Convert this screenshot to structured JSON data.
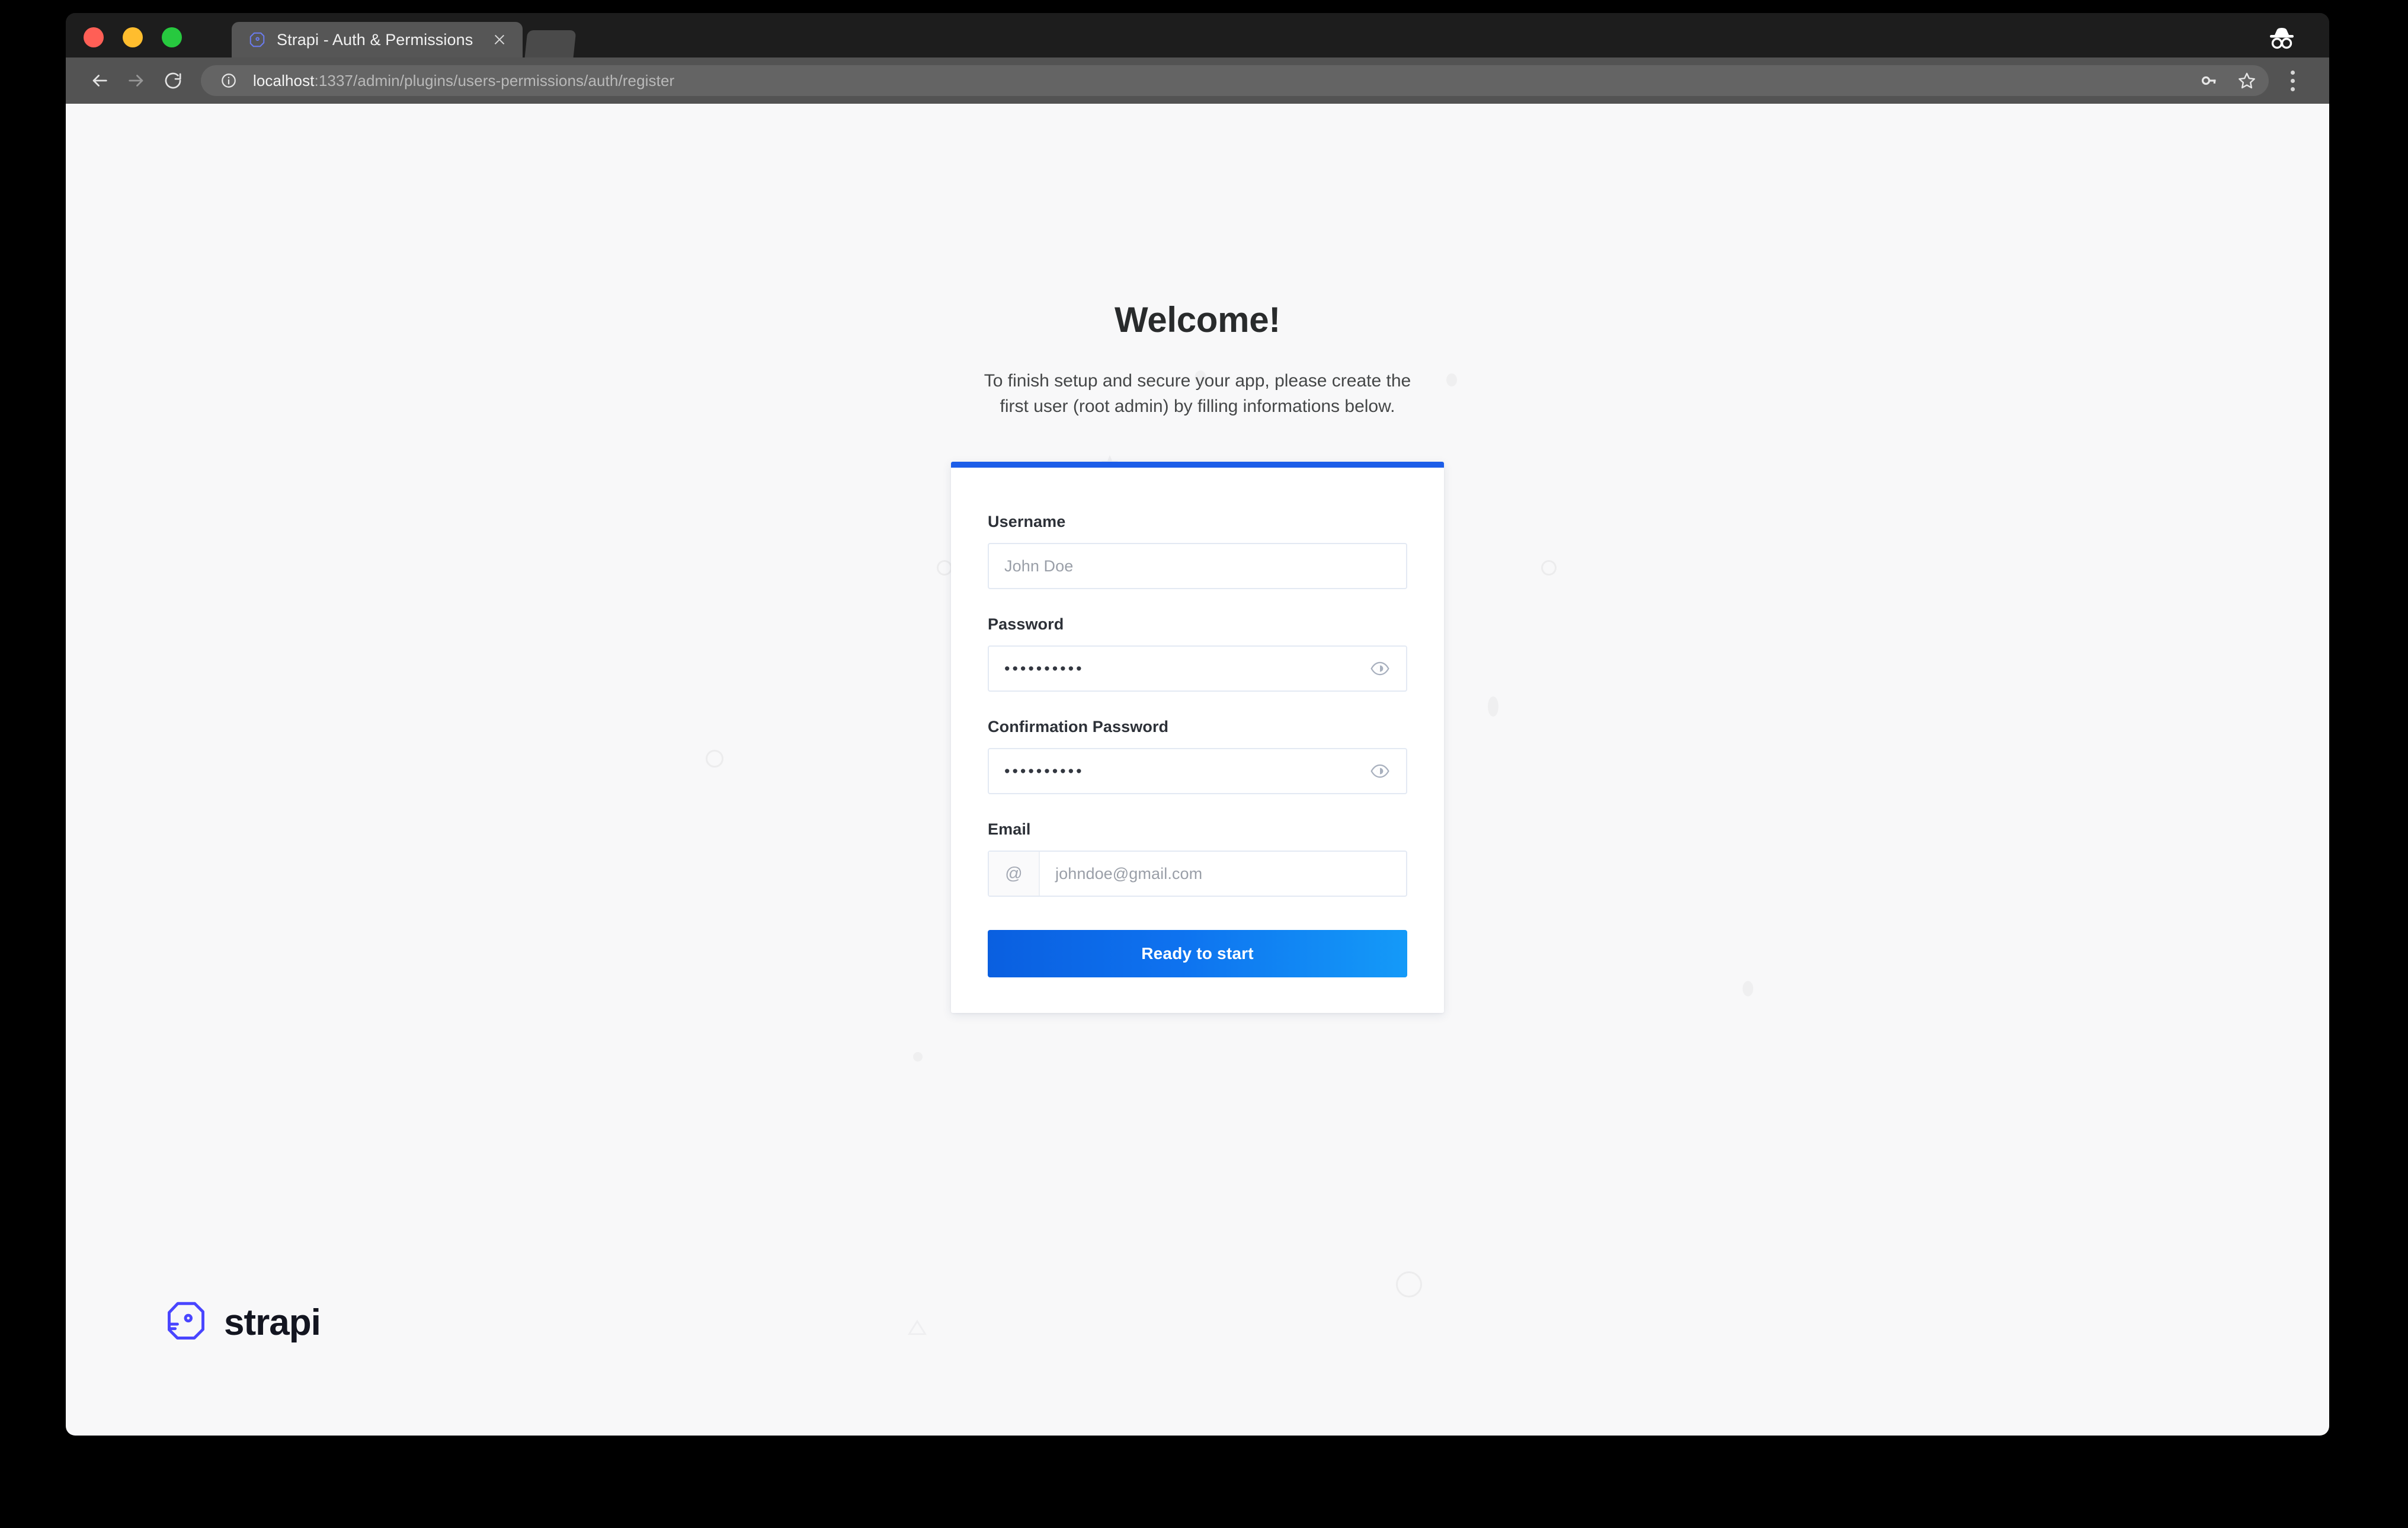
{
  "browser": {
    "tab": {
      "title": "Strapi - Auth & Permissions",
      "favicon_icon": "strapi-favicon",
      "close_icon": "close-icon"
    },
    "new_tab_icon": "new-tab-button",
    "window_controls": {
      "close": "close-window-dot",
      "minimize": "minimize-window-dot",
      "maximize": "maximize-window-dot"
    },
    "incognito_icon": "incognito-icon",
    "nav": {
      "back_icon": "back-arrow-icon",
      "forward_icon": "forward-arrow-icon",
      "reload_icon": "reload-icon"
    },
    "url": {
      "info_icon": "site-info-icon",
      "host": "localhost",
      "rest": ":1337/admin/plugins/users-permissions/auth/register",
      "full": "localhost:1337/admin/plugins/users-permissions/auth/register"
    },
    "actions": {
      "password_key_icon": "key-icon",
      "bookmark_icon": "star-icon",
      "menu_icon": "kebab-menu-icon"
    }
  },
  "page": {
    "title": "Welcome!",
    "subtitle": "To finish setup and secure your app, please create the first user (root admin) by filling informations below.",
    "background_color": "#f8f8f9",
    "accent_color": "#1c5de8"
  },
  "form": {
    "top_accent_color": "#1c5de8",
    "fields": [
      {
        "label": "Username",
        "name": "username-input",
        "value": "",
        "placeholder": "John Doe",
        "type": "text"
      },
      {
        "label": "Password",
        "name": "password-input",
        "value": "••••••••••",
        "placeholder": "",
        "type": "password",
        "toggle_icon": "eye-icon"
      },
      {
        "label": "Confirmation Password",
        "name": "confirmation-password-input",
        "value": "••••••••••",
        "placeholder": "",
        "type": "password",
        "toggle_icon": "eye-icon"
      },
      {
        "label": "Email",
        "name": "email-input",
        "value": "",
        "placeholder": "johndoe@gmail.com",
        "type": "email",
        "addon": "@"
      }
    ],
    "submit_label": "Ready to start"
  },
  "footer": {
    "logo_mark_icon": "strapi-logo-mark",
    "logo_text": "strapi"
  }
}
